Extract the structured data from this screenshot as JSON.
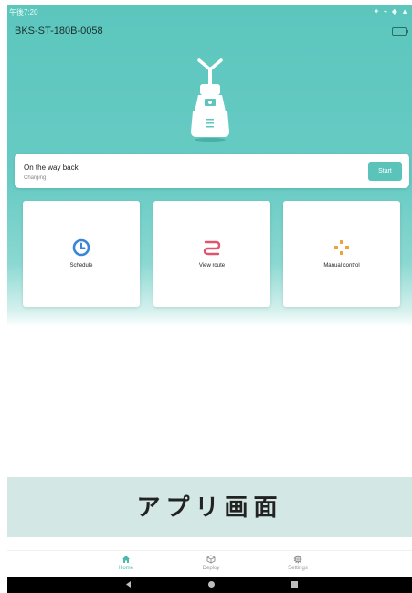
{
  "status_bar": {
    "time": "午後7:20",
    "icons": "✦ ⌁ ◆ ▲"
  },
  "header": {
    "device_name": "BKS-ST-180B-0058"
  },
  "status_card": {
    "title": "On the way back",
    "subtitle": "Charging",
    "start_label": "Start"
  },
  "tiles": [
    {
      "label": "Schedule",
      "icon": "clock-icon",
      "color": "#3a86d6"
    },
    {
      "label": "View route",
      "icon": "route-icon",
      "color": "#e0556d"
    },
    {
      "label": "Manual control",
      "icon": "gamepad-icon",
      "color": "#f0a23a"
    }
  ],
  "banner": {
    "text": "アプリ画面"
  },
  "bottom_nav": [
    {
      "label": "Home",
      "icon": "home-icon",
      "active": true
    },
    {
      "label": "Deploy",
      "icon": "deploy-icon",
      "active": false
    },
    {
      "label": "Settings",
      "icon": "gear-icon",
      "active": false
    }
  ],
  "colors": {
    "accent": "#5ac3ba",
    "active_tab": "#4bb8ae"
  }
}
